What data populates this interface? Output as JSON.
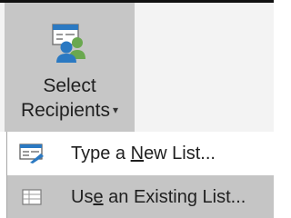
{
  "ribbon": {
    "select_recipients": {
      "line1": "Select",
      "line2": "Recipients",
      "caret": "▾",
      "icon": "recipients-icon"
    }
  },
  "menu": {
    "items": [
      {
        "pre": "Type a ",
        "key": "N",
        "post": "ew List...",
        "icon": "type-new-list-icon"
      },
      {
        "pre": "Us",
        "key": "e",
        "post": " an Existing List...",
        "icon": "existing-list-icon",
        "highlighted": true
      }
    ]
  },
  "colors": {
    "ribbon_bg": "#f3f3f3",
    "button_pressed": "#c6c6c6",
    "item_hover": "#c5c5c5",
    "icon_blue": "#2b79c2",
    "icon_green": "#6aa84f"
  }
}
